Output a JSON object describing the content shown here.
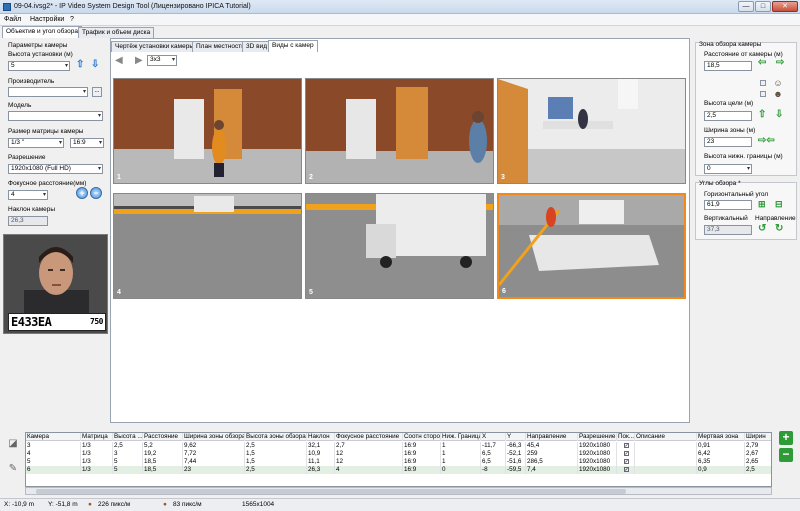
{
  "window": {
    "title": "09-04.ivsg2* - IP Video System Design Tool (Лицензировано  IPICA Tutorial)",
    "min": "—",
    "max": "□",
    "close": "✕"
  },
  "menu": {
    "file": "Файл",
    "settings": "Настройки",
    "help": "?"
  },
  "top_tabs": [
    "Объектив и угол обзора",
    "Трафик и объем диска"
  ],
  "left": {
    "params_title": "Параметры камеры",
    "mount_height_label": "Высота установки (м)",
    "mount_height_value": "5",
    "manufacturer_label": "Производитель",
    "manufacturer_value": "",
    "model_label": "Модель",
    "model_value": "",
    "sensor_label": "Размер матрицы камеры",
    "sensor_value": "1/3 \"",
    "aspect_value": "16:9",
    "resolution_label": "Разрешение",
    "resolution_value": "1920x1080 (Full HD)",
    "focal_label": "Фокусное расстояние(мм)",
    "focal_value": "4",
    "tilt_label": "Наклон камеры",
    "tilt_value": "26,3",
    "plate_text": "Е433ЕА",
    "plate_region": "750",
    "browse_btn": "..."
  },
  "view_tabs": [
    "Чертёж установки камеры",
    "План местности",
    "3D вид",
    "Виды с камер"
  ],
  "view_grid": "3x3",
  "cameras": [
    {
      "num": "1"
    },
    {
      "num": "2"
    },
    {
      "num": "3"
    },
    {
      "num": "4"
    },
    {
      "num": "5"
    },
    {
      "num": "6"
    }
  ],
  "right": {
    "zone_title": "Зона обзора камеры",
    "distance_label": "Расстояние от камеры (м)",
    "distance_value": "18,5",
    "target_height_label": "Высота цели (м)",
    "target_height_value": "2,5",
    "zone_width_label": "Ширина зоны (м)",
    "zone_width_value": "23",
    "lower_bound_label": "Высота нижн. границы (м)",
    "lower_bound_value": "0",
    "angles_title": "Углы обзора *",
    "horiz_label": "Горизонтальный угол",
    "horiz_value": "61,9",
    "vert_label": "Вертикальный",
    "vert_value": "37,3",
    "direction_label": "Направление"
  },
  "table": {
    "headers": [
      "Камера",
      "Матрица",
      "Высота ...",
      "Расстояние",
      "Ширина зоны обзора",
      "Высота зоны обзора",
      "Наклон",
      "Фокусное расстояние",
      "Соотн сторон",
      "Ниж. Граница",
      "X",
      "Y",
      "Направление",
      "Разрешение",
      "Пок...",
      "Описание",
      "Мертвая зона",
      "Ширин"
    ],
    "rows": [
      [
        "3",
        "1/3",
        "2,5",
        "5,2",
        "9,62",
        "2,5",
        "32,1",
        "2,7",
        "16:9",
        "1",
        "-11,7",
        "-66,3",
        "45,4",
        "1920x1080",
        "✓",
        "",
        "0,91",
        "2,79"
      ],
      [
        "4",
        "1/3",
        "3",
        "19,2",
        "7,72",
        "1,5",
        "10,9",
        "12",
        "16:9",
        "1",
        "6,5",
        "-52,1",
        "259",
        "1920x1080",
        "✓",
        "",
        "6,42",
        "2,67"
      ],
      [
        "5",
        "1/3",
        "5",
        "18,5",
        "7,44",
        "1,5",
        "11,1",
        "12",
        "16:9",
        "1",
        "6,5",
        "-51,6",
        "286,5",
        "1920x1080",
        "✓",
        "",
        "6,35",
        "2,65"
      ],
      [
        "6",
        "1/3",
        "5",
        "18,5",
        "23",
        "2,5",
        "26,3",
        "4",
        "16:9",
        "0",
        "-8",
        "-59,5",
        "7,4",
        "1920x1080",
        "✓",
        "",
        "0,9",
        "2,5"
      ]
    ]
  },
  "status": {
    "x": "X: -10,9 m",
    "y": "Y: -51,8 m",
    "ppm1": "226 пикс/м",
    "ppm2": "83 пикс/м",
    "size": "1565x1004"
  },
  "colors": {
    "accent": "#f08a1a",
    "arrow_blue": "#2a7ad0",
    "arrow_green": "#2e9b38"
  }
}
